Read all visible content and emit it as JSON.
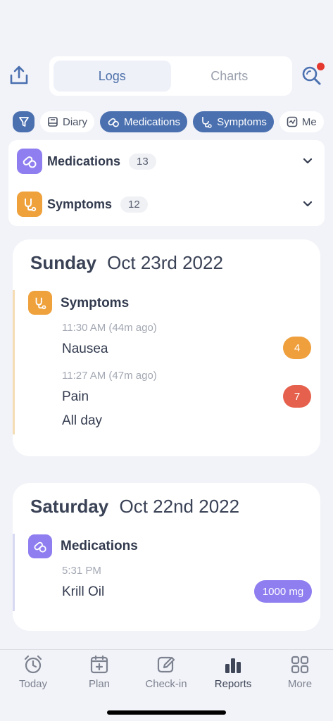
{
  "header": {
    "tabs": [
      {
        "label": "Logs",
        "active": true
      },
      {
        "label": "Charts",
        "active": false
      }
    ],
    "share_icon": "share-icon",
    "search_icon": "search-icon",
    "notification_dot_color": "#e5382f"
  },
  "filters": {
    "chips": [
      {
        "label": "Diary",
        "icon": "book-icon",
        "selected": false
      },
      {
        "label": "Medications",
        "icon": "pill-icon",
        "selected": true
      },
      {
        "label": "Symptoms",
        "icon": "stethoscope-icon",
        "selected": true
      },
      {
        "label": "Me",
        "icon": "chart-icon",
        "selected": false
      }
    ]
  },
  "summary": {
    "rows": [
      {
        "label": "Medications",
        "count": "13",
        "color": "#8f7ef0"
      },
      {
        "label": "Symptoms",
        "count": "12",
        "color": "#efa13c"
      }
    ]
  },
  "days": [
    {
      "day": "Sunday",
      "date": "Oct 23rd 2022",
      "category": "Symptoms",
      "accent": "#f5dcb4",
      "entries": [
        {
          "time": "11:30 AM (44m ago)",
          "name": "Nausea",
          "badge": "4",
          "badge_color": "#ef9f3c"
        },
        {
          "time": "11:27 AM (47m ago)",
          "name": "Pain",
          "extra": "All day",
          "badge": "7",
          "badge_color": "#e5614d"
        }
      ]
    },
    {
      "day": "Saturday",
      "date": "Oct 22nd 2022",
      "category": "Medications",
      "accent": "#d7d9f3",
      "entries": [
        {
          "time": "5:31 PM",
          "name": "Krill Oil",
          "badge": "1000 mg",
          "badge_color": "#8f7ef0"
        }
      ]
    }
  ],
  "nav": {
    "items": [
      {
        "label": "Today",
        "icon": "alarm-clock-icon",
        "active": false
      },
      {
        "label": "Plan",
        "icon": "calendar-plus-icon",
        "active": false
      },
      {
        "label": "Check-in",
        "icon": "edit-icon",
        "active": false
      },
      {
        "label": "Reports",
        "icon": "bar-chart-icon",
        "active": true
      },
      {
        "label": "More",
        "icon": "grid-icon",
        "active": false
      }
    ]
  }
}
